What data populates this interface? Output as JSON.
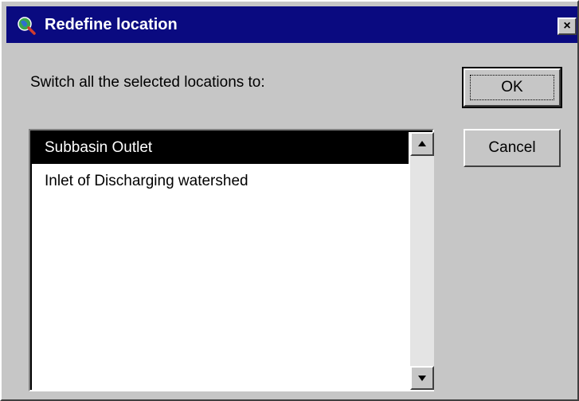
{
  "window": {
    "title": "Redefine location",
    "icon": "globe-magnifier-icon",
    "close_label": "×"
  },
  "prompt": "Switch all the selected locations to:",
  "list": {
    "items": [
      {
        "label": "Subbasin Outlet",
        "selected": true
      },
      {
        "label": "Inlet of Discharging watershed",
        "selected": false
      }
    ]
  },
  "buttons": {
    "ok_label": "OK",
    "cancel_label": "Cancel"
  },
  "colors": {
    "titlebar": "#0a0a80",
    "dialog_face": "#c6c6c6",
    "selection": "#000000"
  }
}
